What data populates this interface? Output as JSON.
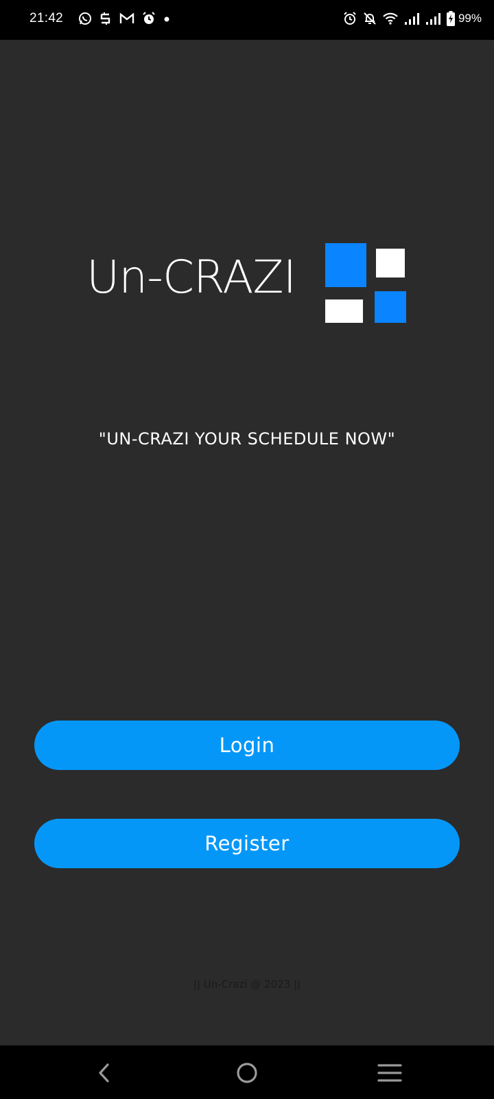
{
  "status_bar": {
    "time": "21:42",
    "left_icons": [
      "whatsapp-icon",
      "sync-icon",
      "gmail-icon",
      "alarm-icon",
      "dot-icon"
    ],
    "right_icons": [
      "alarm-icon",
      "notifications-off-icon",
      "wifi-icon",
      "signal-icon",
      "signal-icon",
      "battery-charging-icon"
    ],
    "battery_percent": "99%"
  },
  "logo": {
    "text": "Un-CRAZI",
    "colors": {
      "blue": "#0a84ff",
      "white": "#ffffff"
    }
  },
  "tagline": "\"UN-CRAZI YOUR SCHEDULE NOW\"",
  "buttons": {
    "login_label": "Login",
    "register_label": "Register",
    "color": "#0597f8"
  },
  "footer": "|| Un-Crazi @ 2023 ||",
  "nav_bar": {
    "icons": [
      "back-icon",
      "home-icon",
      "recents-icon"
    ]
  },
  "theme": {
    "background": "#2b2b2b",
    "bars": "#000000"
  }
}
